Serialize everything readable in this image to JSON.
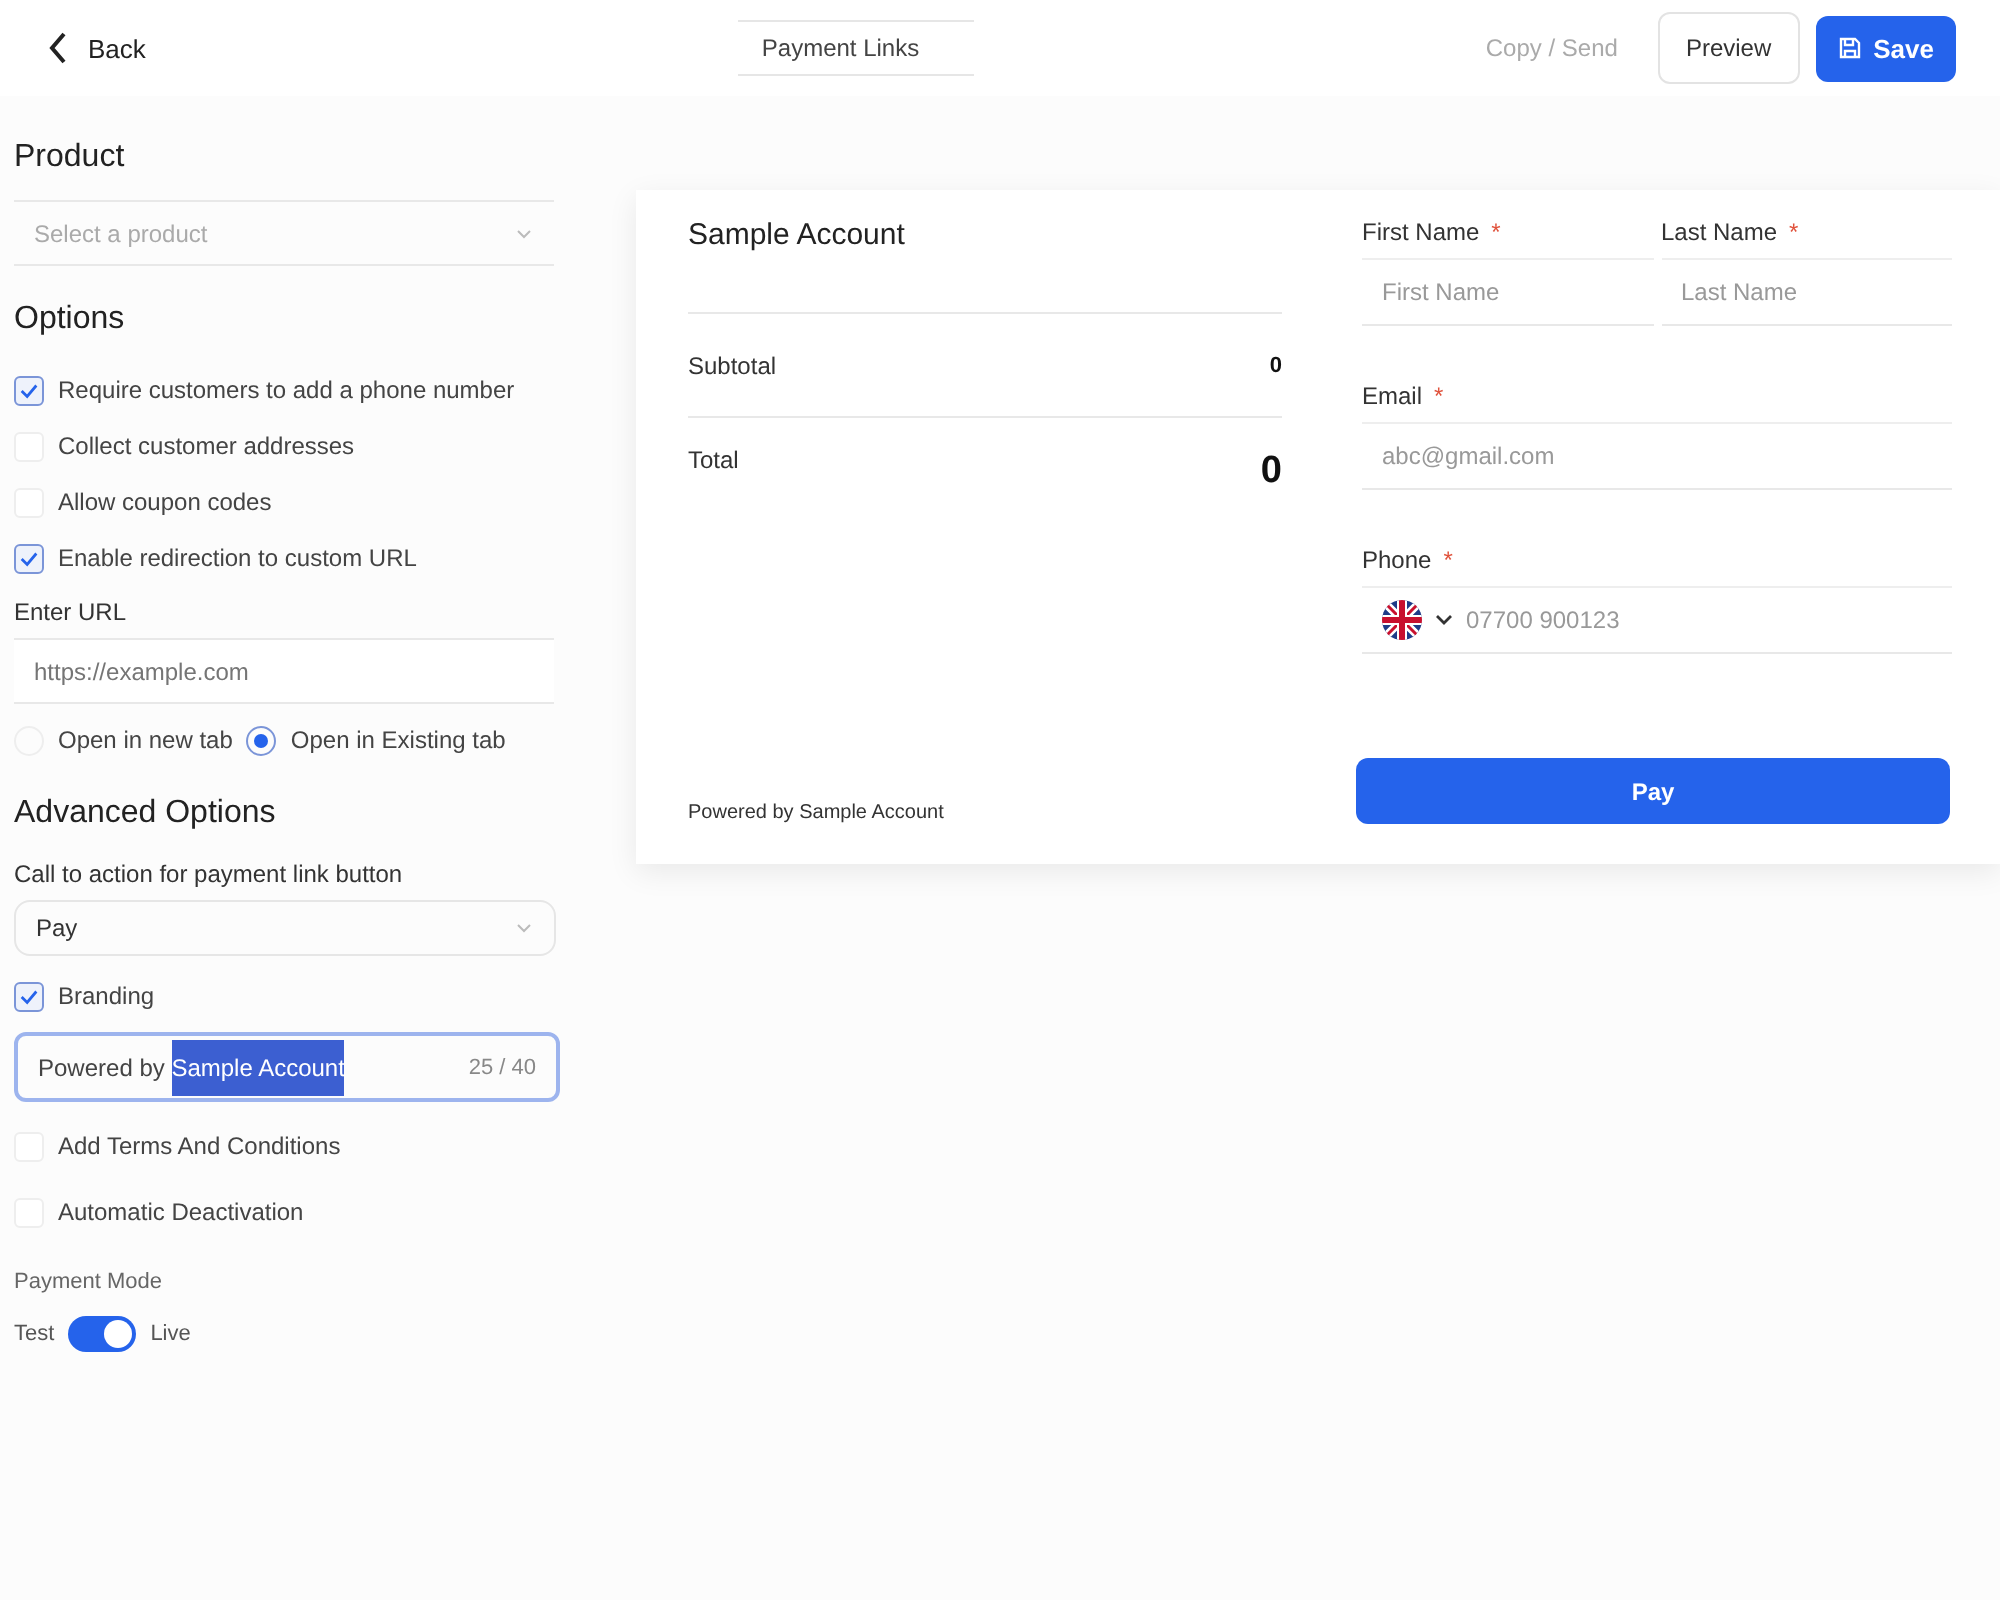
{
  "header": {
    "back": "Back",
    "title": "Payment Links",
    "copy_send": {
      "label": "Copy / Send",
      "disabled": true
    },
    "preview": "Preview",
    "save": "Save"
  },
  "product": {
    "heading": "Product",
    "select": {
      "placeholder": "Select a product"
    }
  },
  "options": {
    "heading": "Options",
    "items": [
      {
        "label": "Require customers to add a phone number",
        "checked": true
      },
      {
        "label": "Collect customer addresses",
        "checked": false
      },
      {
        "label": "Allow coupon codes",
        "checked": false
      },
      {
        "label": "Enable redirection to custom URL",
        "checked": true
      }
    ],
    "url": {
      "label": "Enter URL",
      "placeholder": "https://example.com"
    },
    "open_mode": [
      {
        "label": "Open in new tab",
        "selected": false
      },
      {
        "label": "Open in Existing tab",
        "selected": true
      }
    ]
  },
  "advanced": {
    "heading": "Advanced Options",
    "cta": {
      "label": "Call to action for payment link button",
      "value": "Pay"
    },
    "branding": {
      "label": "Branding",
      "checked": true,
      "value": "Powered by ",
      "highlighted": "Sample Account",
      "counter": "25 / 40"
    },
    "items": [
      {
        "label": "Add Terms And Conditions",
        "checked": false
      },
      {
        "label": "Automatic Deactivation",
        "checked": false
      }
    ],
    "payment_mode": {
      "label": "Payment Mode",
      "left": "Test",
      "right": "Live",
      "on": true
    }
  },
  "preview_card": {
    "account": "Sample Account",
    "subtotal_label": "Subtotal",
    "subtotal": "0",
    "total_label": "Total",
    "total": "0",
    "powered": "Powered by Sample Account",
    "first_name": {
      "label": "First Name",
      "placeholder": "First Name"
    },
    "last_name": {
      "label": "Last Name",
      "placeholder": "Last Name"
    },
    "email": {
      "label": "Email",
      "placeholder": "abc@gmail.com"
    },
    "phone": {
      "label": "Phone",
      "placeholder": "07700 900123"
    },
    "required_mark": "*",
    "pay": "Pay"
  }
}
